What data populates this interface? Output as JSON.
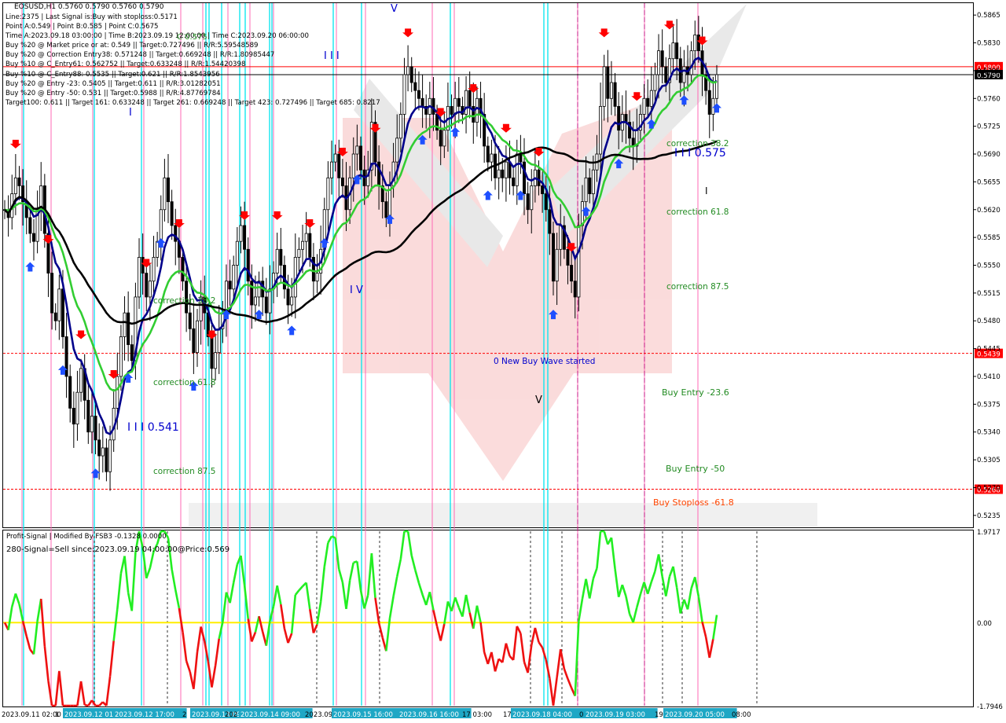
{
  "window": {
    "symbol_line": "EOSUSD,H1  0.5760 0.5790 0.5760 0.5790"
  },
  "info_lines": [
    "Line:2375 | Last Signal is:Buy with stoploss:0.5171",
    "Point A:0.549 | Point B:0.585 | Point C:0.5675",
    "Time A:2023.09.18 03:00:00 | Time B:2023.09.19 12:00:00 | Time C:2023.09.20 06:00:00",
    "Buy %20 @ Market price or at: 0.549 || Target:0.727496 || R/R:5.59548589",
    "Buy %20 @ Correction Entry38: 0.571248 || Target:0.669248 || R/R:1.80985447",
    "Buy %10 @ C_Entry61: 0.562752 || Target:0.633248 || R/R:1.54420398",
    "Buy %10 @ C_Entry88: 0.5535 || Target:0.621 || R/R:1.8543956",
    "Buy %20 @ Entry -23: 0.5405 || Target:0.611 || R/R:3.01282051",
    "Buy %20 @ Entry -50: 0.531 || Target:0.5988 || R/R:4.87769784",
    "Target100: 0.611 || Target 161: 0.633248 || Target 261: 0.669248 || Target 423: 0.727496 || Target 685: 0.8217"
  ],
  "price_axis": {
    "ticks": [
      "0.5865",
      "0.5830",
      "0.5795",
      "0.5760",
      "0.5725",
      "0.5690",
      "0.5655",
      "0.5620",
      "0.5585",
      "0.5550",
      "0.5515",
      "0.5480",
      "0.5445",
      "0.5410",
      "0.5375",
      "0.5340",
      "0.5305",
      "0.5270",
      "0.5235"
    ],
    "tick_values": [
      0.5865,
      0.583,
      0.5795,
      0.576,
      0.5725,
      0.569,
      0.5655,
      0.562,
      0.5585,
      0.555,
      0.5515,
      0.548,
      0.5445,
      0.541,
      0.5375,
      0.534,
      0.5305,
      0.527,
      0.5235
    ],
    "levels": [
      {
        "label": "0.5800",
        "value": 0.58,
        "color": "#ff0000",
        "style": "solid"
      },
      {
        "label": "0.5790",
        "value": 0.579,
        "color": "#000000",
        "style": "solid"
      },
      {
        "label": "0.5439",
        "value": 0.5439,
        "color": "#ff0000",
        "style": "dashed"
      },
      {
        "label": "0.5268",
        "value": 0.5268,
        "color": "#ff0000",
        "style": "dashed"
      }
    ]
  },
  "annotations": {
    "wave_labels": [
      {
        "text": "V"
      },
      {
        "text": "I I I"
      },
      {
        "text": "I"
      },
      {
        "text": "I V"
      },
      {
        "text": "V"
      },
      {
        "text": "I I I 0.541"
      },
      {
        "text": "I I I 0.575"
      },
      {
        "text": "I"
      }
    ],
    "corrections_left": [
      "correction 38.2",
      "correction 61.8",
      "correction 87.5"
    ],
    "corrections_right": [
      "correction 38.2",
      "correction 61.8",
      "correction 87.5"
    ],
    "new_wave": "0 New Buy Wave started",
    "buy_entry_23": "Buy Entry -23.6",
    "buy_entry_50": "Buy Entry -50",
    "buy_stoploss": "Buy Stoploss -61.8",
    "top_label": "C 0.575"
  },
  "sub_window": {
    "title": "Profit-Signal | Modified By FSB3 -0.1328 0.0000",
    "signal": "280-Signal=Sell since:2023.09.19 04:00:00@Price:0.569",
    "axis_ticks": [
      "1.9717",
      "0.00",
      "-1.7946"
    ],
    "axis_values": [
      1.9717,
      0,
      -1.7946
    ]
  },
  "time_axis": {
    "labels": [
      "2023.09.11 02:00",
      "1",
      "2023.09.12 01:00",
      "2023.09.12 17:00",
      "2",
      "2023.09.13 09:00",
      "202",
      "2023.09.14 09:00",
      "2023.09.14 17:00",
      "2023.09.15 16:00",
      "2023.09.16 16:00",
      "17 03:00",
      "17",
      "2023.09.18 04:00",
      "0",
      "2023.09.19 03:00",
      "19",
      "2023.09.20 05:00",
      "08:00"
    ]
  },
  "chart_data": {
    "type": "candlestick",
    "symbol": "EOSUSD",
    "timeframe": "H1",
    "last": {
      "open": 0.576,
      "high": 0.579,
      "low": 0.576,
      "close": 0.579
    },
    "ylim": [
      0.522,
      0.588
    ],
    "sub_ylim": [
      -1.7946,
      1.9717
    ],
    "closes": [
      0.562,
      0.561,
      0.564,
      0.566,
      0.565,
      0.563,
      0.561,
      0.559,
      0.558,
      0.562,
      0.565,
      0.559,
      0.554,
      0.549,
      0.548,
      0.552,
      0.546,
      0.541,
      0.537,
      0.535,
      0.539,
      0.542,
      0.538,
      0.534,
      0.536,
      0.533,
      0.531,
      0.532,
      0.529,
      0.533,
      0.537,
      0.541,
      0.546,
      0.549,
      0.545,
      0.543,
      0.551,
      0.556,
      0.554,
      0.551,
      0.553,
      0.556,
      0.558,
      0.562,
      0.566,
      0.563,
      0.56,
      0.558,
      0.556,
      0.553,
      0.549,
      0.547,
      0.544,
      0.548,
      0.551,
      0.549,
      0.546,
      0.542,
      0.544,
      0.547,
      0.549,
      0.553,
      0.552,
      0.555,
      0.558,
      0.56,
      0.557,
      0.553,
      0.55,
      0.551,
      0.553,
      0.551,
      0.549,
      0.552,
      0.554,
      0.557,
      0.555,
      0.552,
      0.55,
      0.551,
      0.556,
      0.557,
      0.558,
      0.559,
      0.556,
      0.553,
      0.554,
      0.557,
      0.562,
      0.566,
      0.568,
      0.569,
      0.566,
      0.565,
      0.562,
      0.566,
      0.569,
      0.57,
      0.567,
      0.565,
      0.567,
      0.573,
      0.568,
      0.565,
      0.563,
      0.561,
      0.565,
      0.568,
      0.571,
      0.574,
      0.579,
      0.58,
      0.578,
      0.577,
      0.576,
      0.575,
      0.574,
      0.576,
      0.574,
      0.572,
      0.57,
      0.572,
      0.575,
      0.574,
      0.576,
      0.575,
      0.574,
      0.577,
      0.575,
      0.573,
      0.576,
      0.574,
      0.57,
      0.568,
      0.569,
      0.566,
      0.567,
      0.566,
      0.568,
      0.566,
      0.565,
      0.569,
      0.568,
      0.564,
      0.562,
      0.565,
      0.567,
      0.565,
      0.564,
      0.562,
      0.559,
      0.553,
      0.557,
      0.56,
      0.557,
      0.555,
      0.553,
      0.551,
      0.56,
      0.563,
      0.566,
      0.564,
      0.567,
      0.569,
      0.575,
      0.58,
      0.576,
      0.578,
      0.575,
      0.572,
      0.574,
      0.573,
      0.571,
      0.57,
      0.572,
      0.574,
      0.576,
      0.575,
      0.577,
      0.579,
      0.582,
      0.58,
      0.578,
      0.581,
      0.583,
      0.581,
      0.578,
      0.58,
      0.579,
      0.582,
      0.584,
      0.582,
      0.579,
      0.577,
      0.574,
      0.576,
      0.579
    ],
    "series": [
      {
        "name": "MA fast",
        "color": "#00008b"
      },
      {
        "name": "MA medium",
        "color": "#32cd32"
      },
      {
        "name": "MA slow",
        "color": "#000000"
      }
    ]
  }
}
